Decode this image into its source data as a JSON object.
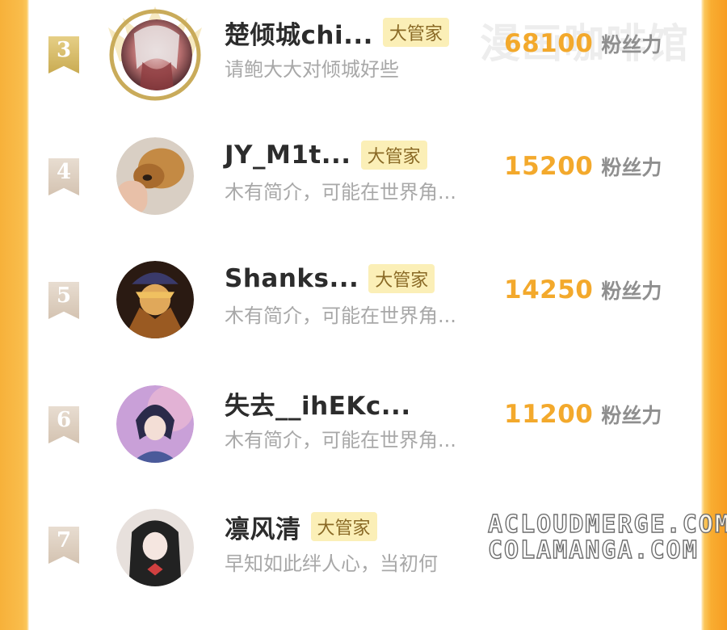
{
  "ranking": [
    {
      "rank": "3",
      "name": "楚倾城chi...",
      "badge": "大管家",
      "bio": "请鲍大大对倾城好些",
      "fans": "68100",
      "fans_label": "粉丝力"
    },
    {
      "rank": "4",
      "name": "JY_M1t...",
      "badge": "大管家",
      "bio": "木有简介，可能在世界角...",
      "fans": "15200",
      "fans_label": "粉丝力"
    },
    {
      "rank": "5",
      "name": "Shanks...",
      "badge": "大管家",
      "bio": "木有简介，可能在世界角...",
      "fans": "14250",
      "fans_label": "粉丝力"
    },
    {
      "rank": "6",
      "name": "失去__ihEKc...",
      "badge": "",
      "bio": "木有简介，可能在世界角...",
      "fans": "11200",
      "fans_label": "粉丝力"
    },
    {
      "rank": "7",
      "name": "凛风清",
      "badge": "大管家",
      "bio": "早知如此绊人心，当初何",
      "fans": "",
      "fans_label": ""
    }
  ],
  "watermarks": {
    "top": "漫画咖啡馆",
    "line1": "ACLOUDMERGE.COM",
    "line2": "COLAMANGA.COM"
  },
  "colors": {
    "accent_orange": "#f3a92c",
    "badge_bg": "#fbefb7",
    "frame_orange": "#f9ad31"
  }
}
